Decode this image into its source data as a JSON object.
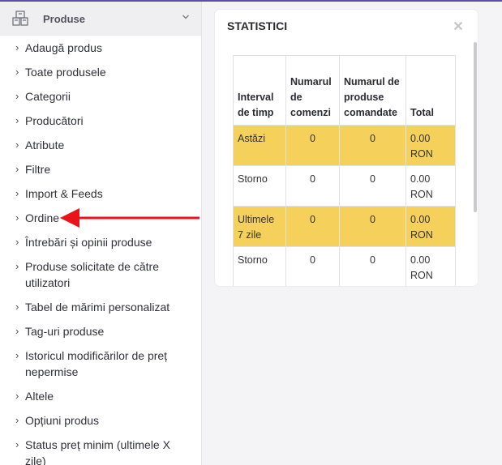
{
  "sidebar": {
    "header": {
      "title": "Produse",
      "icon": "boxes-icon"
    },
    "items": [
      "Adaugă produs",
      "Toate produsele",
      "Categorii",
      "Producători",
      "Atribute",
      "Filtre",
      "Import & Feeds",
      "Ordine",
      "Întrebări și opinii produse",
      "Produse solicitate de către utilizatori",
      "Tabel de mărimi personalizat",
      "Tag-uri produse",
      "Istoricul modificărilor de preț nepermise",
      "Altele",
      "Opțiuni produs",
      "Status preț minim (ultimele X zile)"
    ]
  },
  "annotation": {
    "arrow_color": "#e8141c"
  },
  "stats": {
    "title": "STATISTICI",
    "columns": [
      "Interval de timp",
      "Numarul de comenzi",
      "Numarul de produse comandate",
      "Total"
    ],
    "rows": [
      {
        "interval": "Astăzi",
        "orders": "0",
        "products": "0",
        "total": "0.00 RON",
        "highlight": true
      },
      {
        "interval": "Storno",
        "orders": "0",
        "products": "0",
        "total": "0.00 RON",
        "highlight": false
      },
      {
        "interval": "Ultimele 7 zile",
        "orders": "0",
        "products": "0",
        "total": "0.00 RON",
        "highlight": true
      },
      {
        "interval": "Storno",
        "orders": "0",
        "products": "0",
        "total": "0.00 RON",
        "highlight": false
      },
      {
        "interval": "",
        "orders": "",
        "products": "",
        "total": "",
        "highlight": true
      }
    ],
    "highlight_color": "#f5d05a"
  }
}
